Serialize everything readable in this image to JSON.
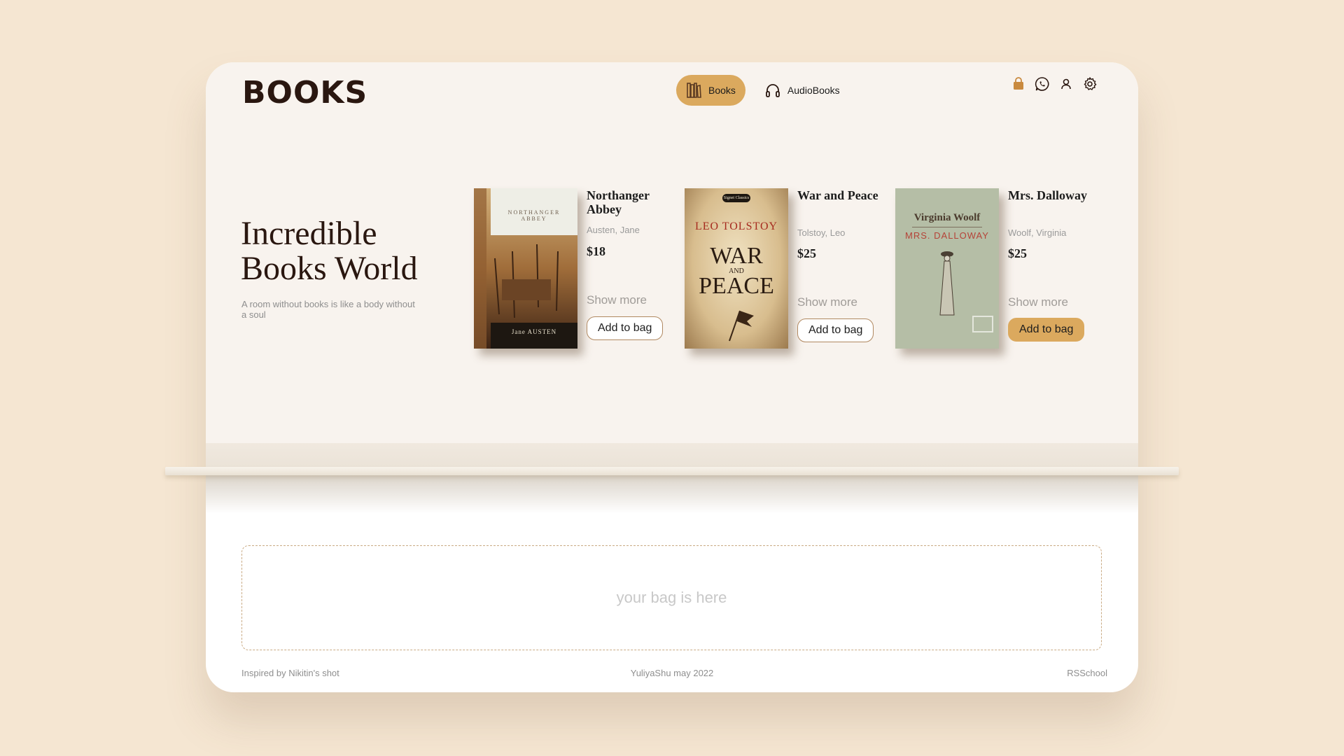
{
  "logo": "BOOKS",
  "nav": {
    "tabs": [
      {
        "label": "Books",
        "icon": "bookshelf-icon",
        "active": true
      },
      {
        "label": "AudioBooks",
        "icon": "headphones-icon",
        "active": false
      }
    ]
  },
  "actions": [
    {
      "name": "bag-icon",
      "color": "#c98a3f"
    },
    {
      "name": "whatsapp-icon",
      "color": "#2a1710"
    },
    {
      "name": "user-icon",
      "color": "#2a1710"
    },
    {
      "name": "gear-icon",
      "color": "#2a1710"
    }
  ],
  "hero": {
    "title": "Incredible Books World",
    "subtitle": "A room without books is like a body without a soul"
  },
  "books": [
    {
      "title": "Northanger Abbey",
      "author": "Austen, Jane",
      "price": "$18",
      "show_more": "Show more",
      "add_label": "Add to bag",
      "cover": {
        "top_text": "NORTHANGER ABBEY",
        "bottom_text": "Jane AUSTEN"
      }
    },
    {
      "title": "War and Peace",
      "author": "Tolstoy, Leo",
      "price": "$25",
      "show_more": "Show more",
      "add_label": "Add to bag",
      "cover": {
        "badge": "Signet Classics",
        "author_text": "LEO TOLSTOY",
        "line1": "WAR",
        "line2": "AND",
        "line3": "PEACE"
      }
    },
    {
      "title": "Mrs. Dalloway",
      "author": "Woolf, Virginia",
      "price": "$25",
      "show_more": "Show more",
      "add_label": "Add to bag",
      "cover": {
        "author_text": "Virginia Woolf",
        "title_text": "MRS. DALLOWAY"
      }
    }
  ],
  "bag": {
    "placeholder": "your bag is here"
  },
  "footer": {
    "left": "Inspired by Nikitin's shot",
    "center": "YuliyaShu may 2022",
    "right": "RSSchool"
  },
  "colors": {
    "background": "#f5e6d2",
    "accent": "#dba95e",
    "dark": "#2a1710"
  }
}
